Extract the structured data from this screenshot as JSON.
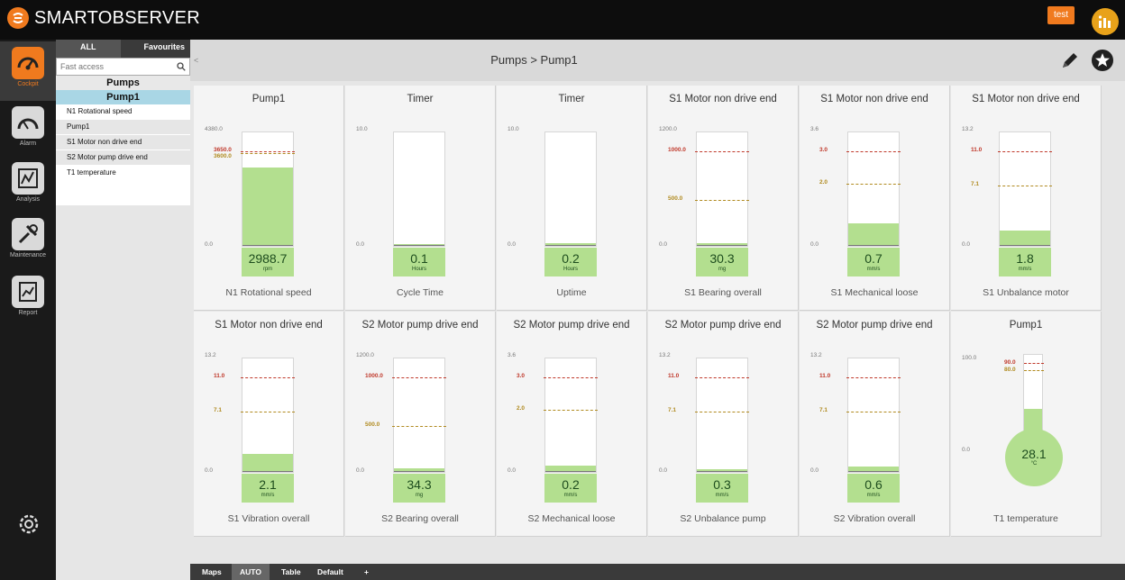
{
  "app": {
    "name": "SMARTOBSERVER",
    "user": "test"
  },
  "nav": [
    {
      "label": "Cockpit",
      "icon": "cockpit-gauge-icon",
      "active": true
    },
    {
      "label": "Alarm",
      "icon": "alarm-gauge-icon",
      "active": false
    },
    {
      "label": "Analysis",
      "icon": "analysis-chart-icon",
      "active": false
    },
    {
      "label": "Maintenance",
      "icon": "maintenance-tools-icon",
      "active": false
    },
    {
      "label": "Report",
      "icon": "report-icon",
      "active": false
    }
  ],
  "tree": {
    "tabs": [
      "ALL",
      "Favourites"
    ],
    "search_placeholder": "Fast access",
    "group": "Pumps",
    "selected": "Pump1",
    "items": [
      "N1 Rotational speed",
      "Pump1",
      "S1 Motor non drive end",
      "S2 Motor pump drive end",
      "T1 temperature"
    ]
  },
  "header": {
    "breadcrumb": "Pumps > Pump1",
    "collapse": "<"
  },
  "cards": [
    {
      "title": "Pump1",
      "subtitle": "N1 Rotational speed",
      "max": "4380.0",
      "min": "0.0",
      "value": "2988.7",
      "unit": "rpm",
      "fill": 0.68,
      "thresholds": [
        {
          "label": "3650.0",
          "pos": 0.833,
          "color": "#c0392b"
        },
        {
          "label": "3600.0",
          "pos": 0.822,
          "color": "#b08a1f"
        }
      ]
    },
    {
      "title": "Timer",
      "subtitle": "Cycle Time",
      "max": "10.0",
      "min": "0.0",
      "value": "0.1",
      "unit": "Hours",
      "fill": 0.01,
      "thresholds": []
    },
    {
      "title": "Timer",
      "subtitle": "Uptime",
      "max": "10.0",
      "min": "0.0",
      "value": "0.2",
      "unit": "Hours",
      "fill": 0.02,
      "thresholds": []
    },
    {
      "title": "S1 Motor non drive end",
      "subtitle": "S1 Bearing overall",
      "max": "1200.0",
      "min": "0.0",
      "value": "30.3",
      "unit": "mg",
      "fill": 0.025,
      "thresholds": [
        {
          "label": "1000.0",
          "pos": 0.833,
          "color": "#c0392b"
        },
        {
          "label": "500.0",
          "pos": 0.417,
          "color": "#b08a1f"
        }
      ]
    },
    {
      "title": "S1 Motor non drive end",
      "subtitle": "S1 Mechanical loose",
      "max": "3.6",
      "min": "0.0",
      "value": "0.7",
      "unit": "mm/s",
      "fill": 0.194,
      "thresholds": [
        {
          "label": "3.0",
          "pos": 0.833,
          "color": "#c0392b"
        },
        {
          "label": "2.0",
          "pos": 0.556,
          "color": "#b08a1f"
        }
      ]
    },
    {
      "title": "S1 Motor non drive end",
      "subtitle": "S1 Unbalance motor",
      "max": "13.2",
      "min": "0.0",
      "value": "1.8",
      "unit": "mm/s",
      "fill": 0.136,
      "thresholds": [
        {
          "label": "11.0",
          "pos": 0.833,
          "color": "#c0392b"
        },
        {
          "label": "7.1",
          "pos": 0.538,
          "color": "#b08a1f"
        }
      ]
    },
    {
      "title": "S1 Motor non drive end",
      "subtitle": "S1 Vibration overall",
      "max": "13.2",
      "min": "0.0",
      "value": "2.1",
      "unit": "mm/s",
      "fill": 0.159,
      "thresholds": [
        {
          "label": "11.0",
          "pos": 0.833,
          "color": "#c0392b"
        },
        {
          "label": "7.1",
          "pos": 0.538,
          "color": "#b08a1f"
        }
      ]
    },
    {
      "title": "S2 Motor pump drive end",
      "subtitle": "S2 Bearing overall",
      "max": "1200.0",
      "min": "0.0",
      "value": "34.3",
      "unit": "mg",
      "fill": 0.029,
      "thresholds": [
        {
          "label": "1000.0",
          "pos": 0.833,
          "color": "#c0392b"
        },
        {
          "label": "500.0",
          "pos": 0.417,
          "color": "#b08a1f"
        }
      ]
    },
    {
      "title": "S2 Motor pump drive end",
      "subtitle": "S2 Mechanical loose",
      "max": "3.6",
      "min": "0.0",
      "value": "0.2",
      "unit": "mm/s",
      "fill": 0.056,
      "thresholds": [
        {
          "label": "3.0",
          "pos": 0.833,
          "color": "#c0392b"
        },
        {
          "label": "2.0",
          "pos": 0.556,
          "color": "#b08a1f"
        }
      ]
    },
    {
      "title": "S2 Motor pump drive end",
      "subtitle": "S2 Unbalance pump",
      "max": "13.2",
      "min": "0.0",
      "value": "0.3",
      "unit": "mm/s",
      "fill": 0.023,
      "thresholds": [
        {
          "label": "11.0",
          "pos": 0.833,
          "color": "#c0392b"
        },
        {
          "label": "7.1",
          "pos": 0.538,
          "color": "#b08a1f"
        }
      ]
    },
    {
      "title": "S2 Motor pump drive end",
      "subtitle": "S2 Vibration overall",
      "max": "13.2",
      "min": "0.0",
      "value": "0.6",
      "unit": "mm/s",
      "fill": 0.045,
      "thresholds": [
        {
          "label": "11.0",
          "pos": 0.833,
          "color": "#c0392b"
        },
        {
          "label": "7.1",
          "pos": 0.538,
          "color": "#b08a1f"
        }
      ]
    }
  ],
  "thermo": {
    "title": "Pump1",
    "subtitle": "T1 temperature",
    "max": "100.0",
    "min": "0.0",
    "value": "28.1",
    "unit": "°C",
    "fill": 0.28,
    "thresholds": [
      {
        "label": "90.0",
        "pos": 0.9,
        "color": "#c0392b"
      },
      {
        "label": "80.0",
        "pos": 0.8,
        "color": "#b08a1f"
      }
    ]
  },
  "bottom_tabs": [
    {
      "label": "Maps",
      "active": false
    },
    {
      "label": "AUTO",
      "active": true
    },
    {
      "label": "Table",
      "active": false
    },
    {
      "label": "Default",
      "active": false
    },
    {
      "label": "+",
      "active": false
    }
  ],
  "colors": {
    "accent": "#f07a1e",
    "fill": "#b3df8f",
    "alarm": "#c0392b",
    "warning": "#b08a1f",
    "selected": "#a9d6e5"
  }
}
